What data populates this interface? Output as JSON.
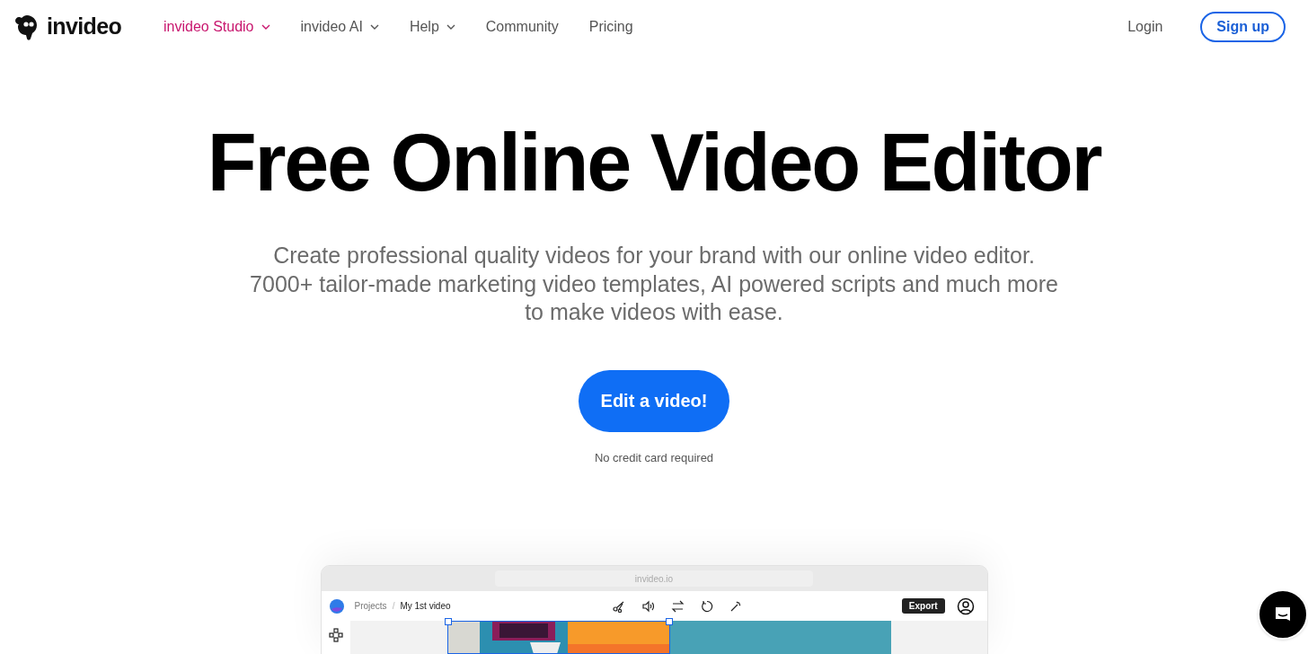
{
  "brand": {
    "name": "invideo"
  },
  "nav": [
    {
      "label": "invideo Studio",
      "selected": true,
      "dropdown": true
    },
    {
      "label": "invideo AI",
      "selected": false,
      "dropdown": true
    },
    {
      "label": "Help",
      "selected": false,
      "dropdown": true
    },
    {
      "label": "Community",
      "selected": false,
      "dropdown": false
    },
    {
      "label": "Pricing",
      "selected": false,
      "dropdown": false
    }
  ],
  "auth": {
    "login": "Login",
    "signup": "Sign up"
  },
  "hero": {
    "title": "Free Online Video Editor",
    "subtitle": "Create professional quality videos for your brand with our online video editor. 7000+ tailor-made marketing video templates, AI powered scripts and much more to make videos with ease.",
    "cta": "Edit a video!",
    "note": "No credit card required"
  },
  "preview": {
    "address": "invideo.io",
    "breadcrumb": [
      "Projects",
      "My 1st video"
    ],
    "breadcrumb_separator": "/",
    "export": "Export"
  }
}
